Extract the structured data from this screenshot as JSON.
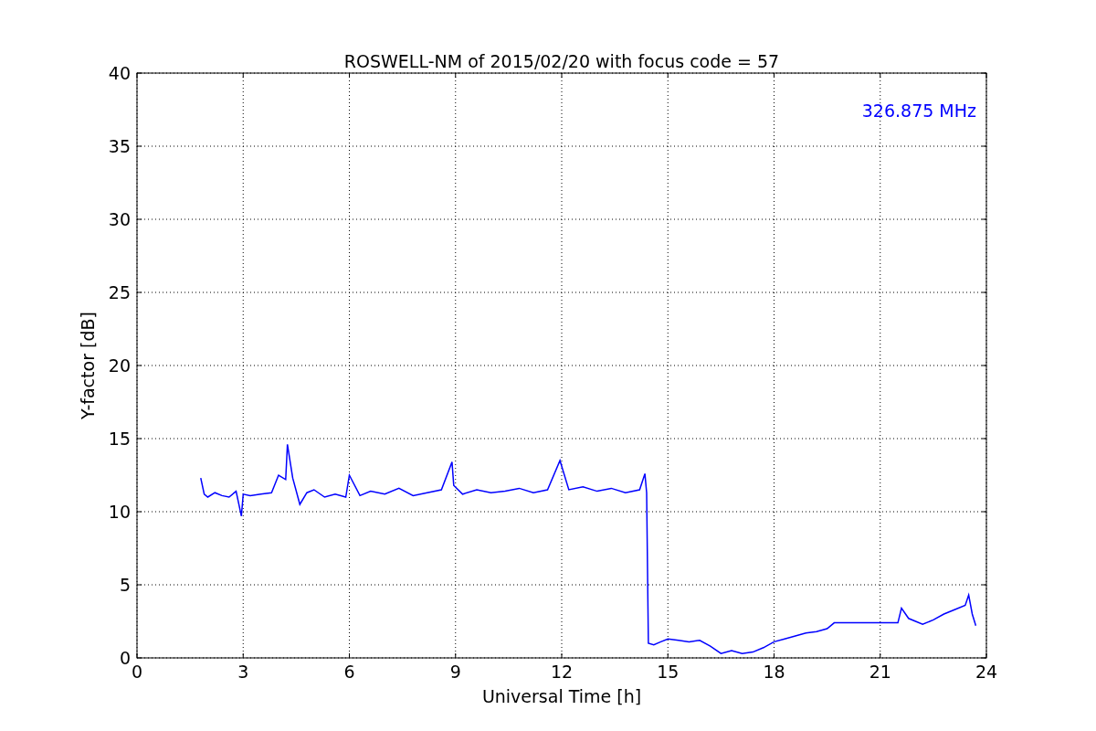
{
  "figure": {
    "chart_data": {
      "type": "line",
      "grid": true,
      "title": "ROSWELL-NM of 2015/02/20 with focus code = 57",
      "xlabel": "Universal Time [h]",
      "ylabel": "Y-factor [dB]",
      "xlim": [
        0,
        24
      ],
      "ylim": [
        0,
        40
      ],
      "xticks": [
        0,
        3,
        6,
        9,
        12,
        15,
        18,
        21,
        24
      ],
      "yticks": [
        0,
        5,
        10,
        15,
        20,
        25,
        30,
        35,
        40
      ],
      "x": [
        1.8,
        1.9,
        2.0,
        2.2,
        2.4,
        2.6,
        2.8,
        2.95,
        3.0,
        3.2,
        3.5,
        3.8,
        4.0,
        4.2,
        4.25,
        4.4,
        4.6,
        4.8,
        5.0,
        5.3,
        5.6,
        5.9,
        6.0,
        6.3,
        6.6,
        7.0,
        7.4,
        7.8,
        8.2,
        8.6,
        8.9,
        8.95,
        9.2,
        9.6,
        10.0,
        10.4,
        10.8,
        11.2,
        11.6,
        11.95,
        12.2,
        12.6,
        13.0,
        13.4,
        13.8,
        14.2,
        14.35,
        14.4,
        14.45,
        14.6,
        14.8,
        15.0,
        15.3,
        15.6,
        15.9,
        16.2,
        16.5,
        16.8,
        17.1,
        17.4,
        17.7,
        18.0,
        18.3,
        18.6,
        18.9,
        19.2,
        19.5,
        19.7,
        21.5,
        21.6,
        21.8,
        22.0,
        22.2,
        22.5,
        22.8,
        23.1,
        23.4,
        23.5,
        23.6,
        23.7
      ],
      "series": [
        {
          "name": "326.875 MHz",
          "color": "#0000ff",
          "values": [
            12.3,
            11.2,
            11.0,
            11.3,
            11.1,
            11.0,
            11.4,
            9.7,
            11.2,
            11.1,
            11.2,
            11.3,
            12.5,
            12.2,
            14.6,
            12.3,
            10.5,
            11.3,
            11.5,
            11.0,
            11.2,
            11.0,
            12.5,
            11.1,
            11.4,
            11.2,
            11.6,
            11.1,
            11.3,
            11.5,
            13.4,
            11.8,
            11.2,
            11.5,
            11.3,
            11.4,
            11.6,
            11.3,
            11.5,
            13.5,
            11.5,
            11.7,
            11.4,
            11.6,
            11.3,
            11.5,
            12.6,
            11.3,
            1.0,
            0.9,
            1.1,
            1.3,
            1.2,
            1.1,
            1.2,
            0.8,
            0.3,
            0.5,
            0.3,
            0.4,
            0.7,
            1.1,
            1.3,
            1.5,
            1.7,
            1.8,
            2.0,
            2.4,
            2.4,
            3.4,
            2.7,
            2.5,
            2.3,
            2.6,
            3.0,
            3.3,
            3.6,
            4.3,
            3.0,
            2.2
          ]
        }
      ]
    }
  }
}
